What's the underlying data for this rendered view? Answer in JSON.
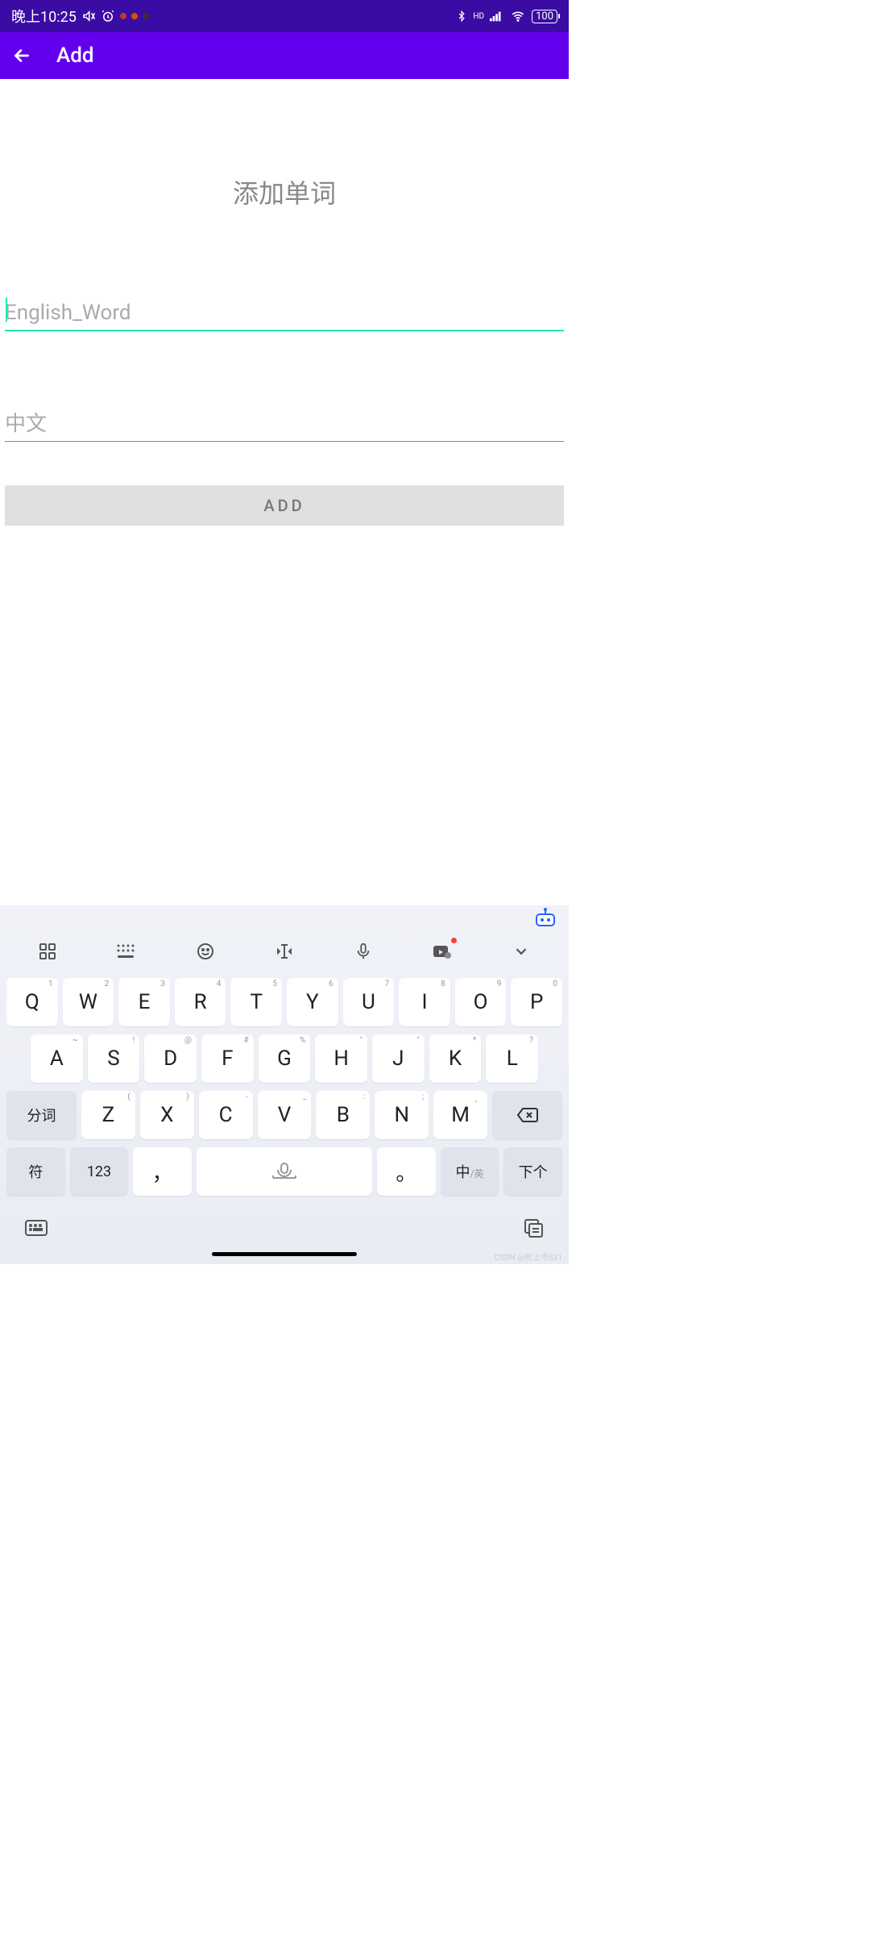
{
  "status_bar": {
    "time": "晚上10:25",
    "battery": "100",
    "hd_label": "HD"
  },
  "app_bar": {
    "title": "Add"
  },
  "main": {
    "heading": "添加单词",
    "english_placeholder": "English_Word",
    "english_value": "",
    "chinese_placeholder": "中文",
    "chinese_value": "",
    "add_button": "ADD"
  },
  "keyboard": {
    "row1": [
      {
        "main": "Q",
        "hint": "1"
      },
      {
        "main": "W",
        "hint": "2"
      },
      {
        "main": "E",
        "hint": "3"
      },
      {
        "main": "R",
        "hint": "4"
      },
      {
        "main": "T",
        "hint": "5"
      },
      {
        "main": "Y",
        "hint": "6"
      },
      {
        "main": "U",
        "hint": "7"
      },
      {
        "main": "I",
        "hint": "8"
      },
      {
        "main": "O",
        "hint": "9"
      },
      {
        "main": "P",
        "hint": "0"
      }
    ],
    "row2": [
      {
        "main": "A",
        "hint": "~"
      },
      {
        "main": "S",
        "hint": "!"
      },
      {
        "main": "D",
        "hint": "@"
      },
      {
        "main": "F",
        "hint": "#"
      },
      {
        "main": "G",
        "hint": "%"
      },
      {
        "main": "H",
        "hint": "\""
      },
      {
        "main": "J",
        "hint": "\""
      },
      {
        "main": "K",
        "hint": "*"
      },
      {
        "main": "L",
        "hint": "?"
      }
    ],
    "row3_func_left": "分词",
    "row3": [
      {
        "main": "Z",
        "hint": "("
      },
      {
        "main": "X",
        "hint": ")"
      },
      {
        "main": "C",
        "hint": "-"
      },
      {
        "main": "V",
        "hint": "_"
      },
      {
        "main": "B",
        "hint": ":"
      },
      {
        "main": "N",
        "hint": ";"
      },
      {
        "main": "M",
        "hint": "、"
      }
    ],
    "row4": {
      "symbol": "符",
      "num": "123",
      "comma": "，",
      "period": "。",
      "lang": "中",
      "lang_sub": "/英",
      "next": "下个"
    }
  },
  "watermark": "CSDN @枕上书531"
}
